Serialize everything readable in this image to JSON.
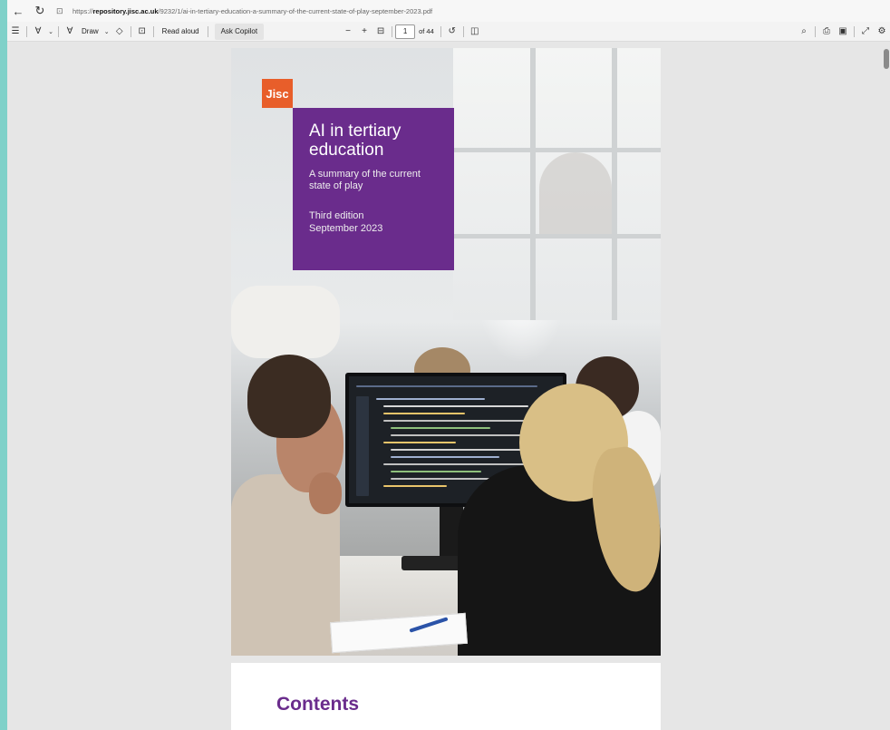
{
  "browser": {
    "url_prefix": "https://",
    "url_host": "repository.jisc.ac.uk",
    "url_path": "/9232/1/ai-in-tertiary-education-a-summary-of-the-current-state-of-play-september-2023.pdf"
  },
  "toolbar": {
    "draw_label": "Draw",
    "read_aloud_label": "Read aloud",
    "ask_copilot_label": "Ask Copilot",
    "page_number": "1",
    "page_total": "of 44"
  },
  "cover": {
    "logo_text": "Jisc",
    "title": "AI in tertiary education",
    "subtitle": "A summary of the current state of play",
    "edition": "Third edition",
    "date": "September 2023",
    "brand_purple": "#6a2c8c",
    "brand_orange": "#e85e2a"
  },
  "page2": {
    "heading": "Contents"
  }
}
